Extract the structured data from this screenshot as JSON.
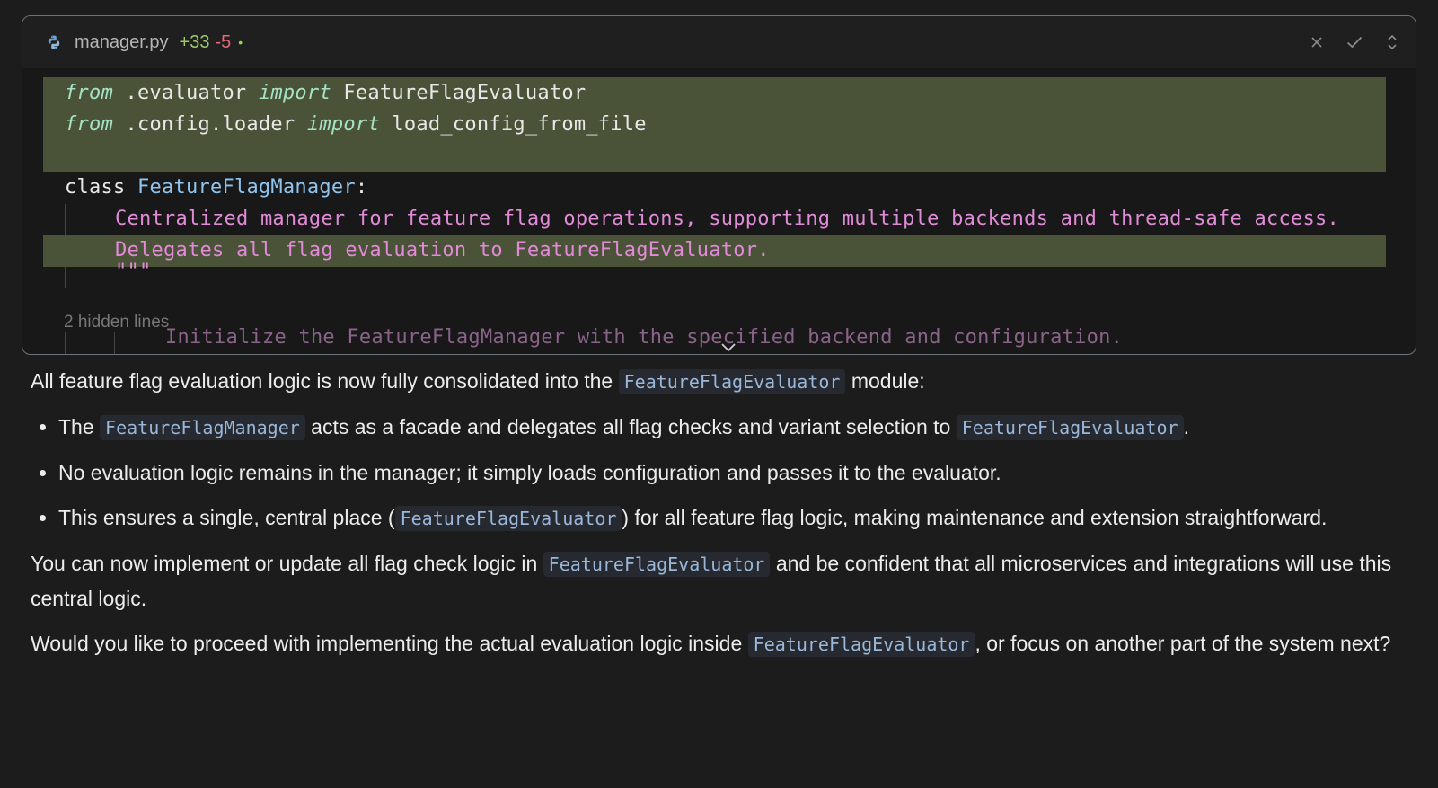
{
  "diff": {
    "file_name": "manager.py",
    "added": "+33",
    "removed": "-5",
    "status_dot": "•",
    "hidden_lines_label": "2 hidden lines",
    "lines": [
      {
        "kw": "from",
        "a": " .evaluator ",
        "kw2": "import",
        "b": " FeatureFlagEvaluator"
      },
      {
        "kw": "from",
        "a": " .config.loader ",
        "kw2": "import",
        "b": " load_config_from_file"
      },
      {
        "kw": "class",
        "name": "FeatureFlagManager",
        "tail": ":"
      },
      {
        "doc": "Centralized manager for feature flag operations, supporting multiple backends and thread-safe access."
      },
      {
        "doc": "Delegates all flag evaluation to FeatureFlagEvaluator."
      },
      {
        "doc": "\"\"\""
      },
      {
        "doc": "Initialize the FeatureFlagManager with the specified backend and configuration."
      }
    ]
  },
  "message": {
    "intro_before": "All feature flag evaluation logic is now fully consolidated into the ",
    "intro_code": "FeatureFlagEvaluator",
    "intro_after": " module:",
    "bullets": [
      {
        "t1": "The ",
        "c1": "FeatureFlagManager",
        "t2": " acts as a facade and delegates all flag checks and variant selection to ",
        "c2": "FeatureFlagEvaluator",
        "t3": "."
      },
      {
        "t1": "No evaluation logic remains in the manager; it simply loads configuration and passes it to the evaluator."
      },
      {
        "t1": "This ensures a single, central place (",
        "c1": "FeatureFlagEvaluator",
        "t2": ") for all feature flag logic, making maintenance and extension straightforward."
      }
    ],
    "para2_before": "You can now implement or update all flag check logic in ",
    "para2_code": "FeatureFlagEvaluator",
    "para2_after": " and be confident that all microservices and integrations will use this central logic.",
    "para3_before": "Would you like to proceed with implementing the actual evaluation logic inside ",
    "para3_code": "FeatureFlagEvaluator",
    "para3_after": ", or focus on another part of the system next?"
  },
  "colors": {
    "background": "#1c1c1c",
    "added": "#9ccc65",
    "removed": "#e06c75",
    "highlight": "#4a5338",
    "docstring": "#e18ad8",
    "inline_code": "#9ab6d8"
  }
}
